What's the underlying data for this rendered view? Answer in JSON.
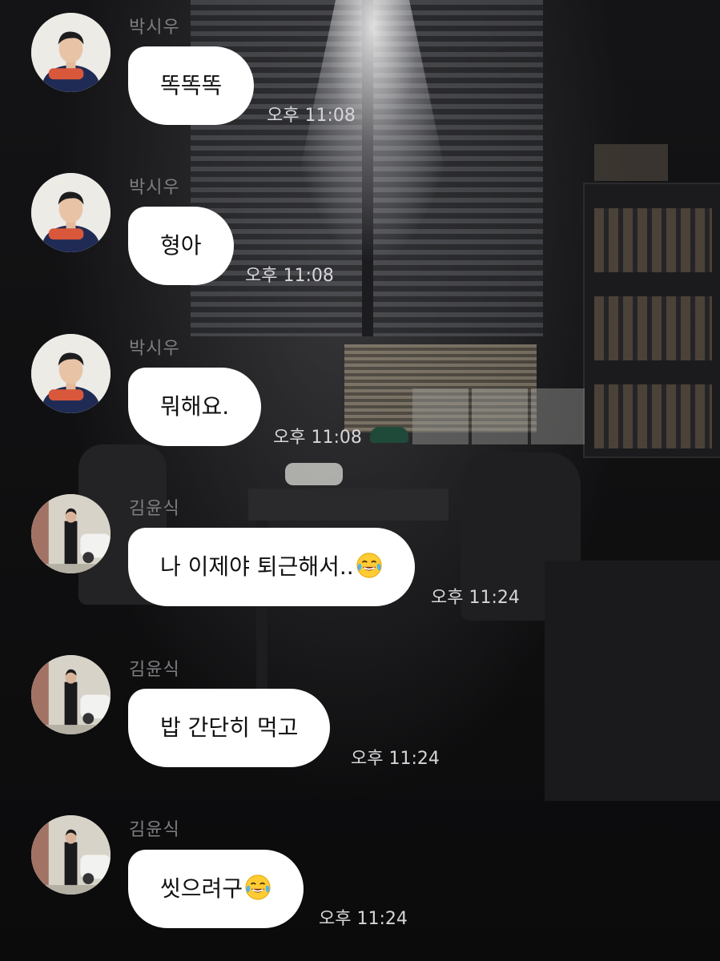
{
  "messages": [
    {
      "sender": "박시우",
      "text": "똑똑똑",
      "emoji": "",
      "time": "오후 11:08"
    },
    {
      "sender": "박시우",
      "text": "형아",
      "emoji": "",
      "time": "오후 11:08"
    },
    {
      "sender": "박시우",
      "text": "뭐해요.",
      "emoji": "",
      "time": "오후 11:08"
    },
    {
      "sender": "김윤식",
      "text": "나 이제야 퇴근해서..",
      "emoji": "face-with-tears-of-joy",
      "time": "오후 11:24"
    },
    {
      "sender": "김윤식",
      "text": "밥 간단히 먹고",
      "emoji": "",
      "time": "오후 11:24"
    },
    {
      "sender": "김윤식",
      "text": "씻으려구",
      "emoji": "face-with-tears-of-joy",
      "time": "오후 11:24"
    }
  ],
  "colors": {
    "bubble": "#ffffff",
    "sender_name": "#7f7f82",
    "timestamp": "#d6d6d8",
    "background": "#0e0e0f"
  }
}
